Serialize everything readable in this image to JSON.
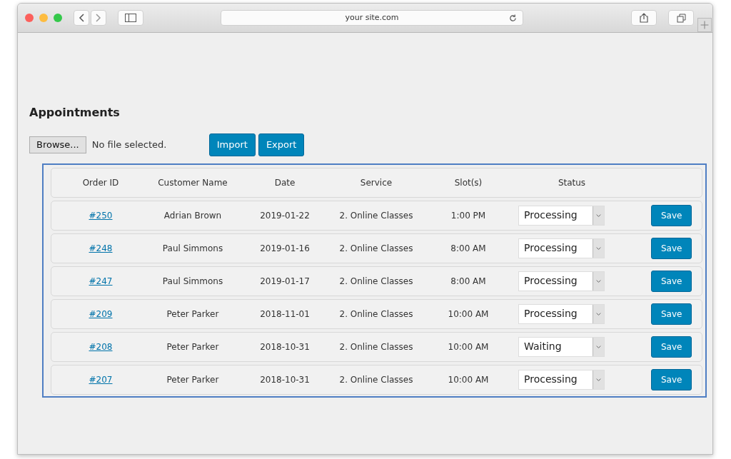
{
  "browser": {
    "url": "your site.com"
  },
  "page": {
    "title": "Appointments"
  },
  "file_input": {
    "button": "Browse...",
    "status": "No file selected."
  },
  "actions": [
    "Import",
    "Export"
  ],
  "table": {
    "columns": [
      "Order ID",
      "Customer Name",
      "Date",
      "Service",
      "Slot(s)",
      "Status"
    ],
    "rows": [
      {
        "order_id": "#250",
        "customer": "Adrian Brown",
        "date": "2019-01-22",
        "service": "2. Online Classes",
        "slots": "1:00 PM",
        "status": "Processing",
        "action": "Save"
      },
      {
        "order_id": "#248",
        "customer": "Paul Simmons",
        "date": "2019-01-16",
        "service": "2. Online Classes",
        "slots": "8:00 AM",
        "status": "Processing",
        "action": "Save"
      },
      {
        "order_id": "#247",
        "customer": "Paul Simmons",
        "date": "2019-01-17",
        "service": "2. Online Classes",
        "slots": "8:00 AM",
        "status": "Processing",
        "action": "Save"
      },
      {
        "order_id": "#209",
        "customer": "Peter Parker",
        "date": "2018-11-01",
        "service": "2. Online Classes",
        "slots": "10:00 AM",
        "status": "Processing",
        "action": "Save"
      },
      {
        "order_id": "#208",
        "customer": "Peter Parker",
        "date": "2018-10-31",
        "service": "2. Online Classes",
        "slots": "10:00 AM",
        "status": "Waiting",
        "action": "Save"
      },
      {
        "order_id": "#207",
        "customer": "Peter Parker",
        "date": "2018-10-31",
        "service": "2. Online Classes",
        "slots": "10:00 AM",
        "status": "Processing",
        "action": "Save"
      }
    ]
  }
}
